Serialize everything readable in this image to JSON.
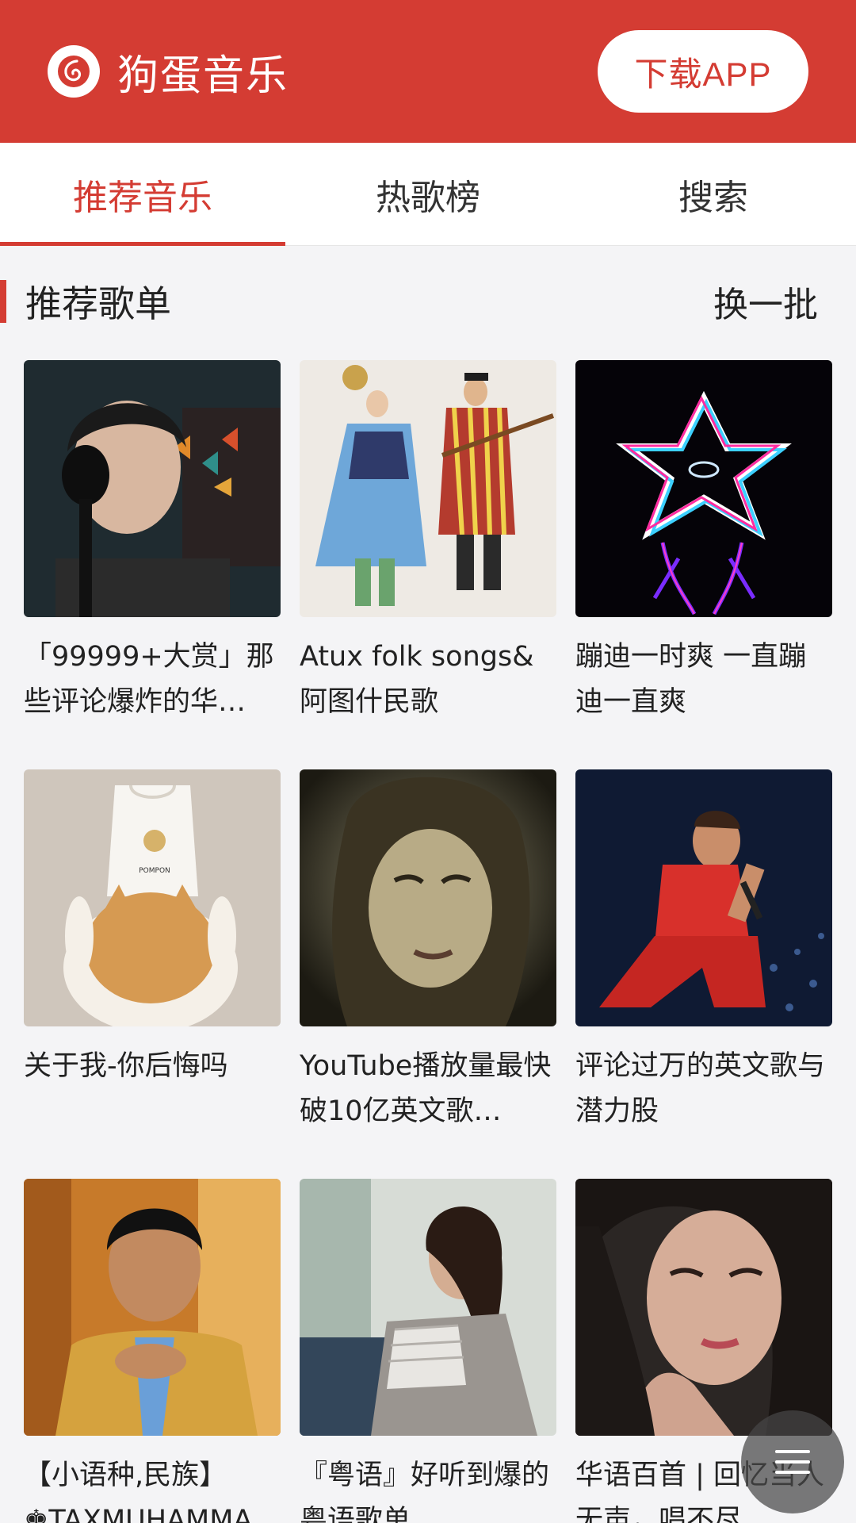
{
  "header": {
    "app_name": "狗蛋音乐",
    "logo_icon": "netease-music-icon",
    "download_label": "下载APP",
    "brand_color": "#d43c33"
  },
  "tabs": [
    {
      "label": "推荐音乐",
      "active": true
    },
    {
      "label": "热歌榜",
      "active": false
    },
    {
      "label": "搜索",
      "active": false
    }
  ],
  "section": {
    "title": "推荐歌单",
    "refresh_label": "换一批"
  },
  "playlists": [
    {
      "title": "「99999+大赏」那些评论爆炸的华…"
    },
    {
      "title": "Atux folk songs& 阿图什民歌"
    },
    {
      "title": "蹦迪一时爽 一直蹦迪一直爽"
    },
    {
      "title": "关于我-你后悔吗"
    },
    {
      "title": "YouTube播放量最快破10亿英文歌…"
    },
    {
      "title": "评论过万的英文歌与潜力股"
    },
    {
      "title": "【小语种,民族】♚TAXMUHAMMA…"
    },
    {
      "title": "『粤语』好听到爆的粤语歌单."
    },
    {
      "title": "华语百首 | 回忆当人无声，唱不尽…"
    }
  ],
  "fab": {
    "icon": "menu-icon"
  }
}
